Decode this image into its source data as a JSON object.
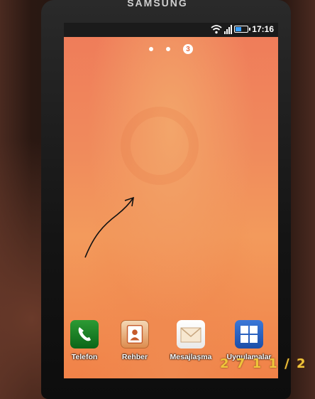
{
  "device": {
    "brand": "SAMSUNG"
  },
  "statusbar": {
    "time": "17:16",
    "battery_level": 0.5
  },
  "home": {
    "current_page": "3",
    "pages": 3
  },
  "dock": {
    "items": [
      {
        "label": "Telefon",
        "icon": "phone-icon"
      },
      {
        "label": "Rehber",
        "icon": "contacts-icon"
      },
      {
        "label": "Mesajlaşma",
        "icon": "envelope-icon"
      },
      {
        "label": "Uygulamalar",
        "icon": "apps-grid-icon"
      }
    ]
  },
  "photo": {
    "date_stamp": "2 7 1 1 / 2"
  },
  "colors": {
    "wallpaper": "#f08a5c",
    "statusbar": "#1b1b1b",
    "battery": "#39a0ff"
  }
}
